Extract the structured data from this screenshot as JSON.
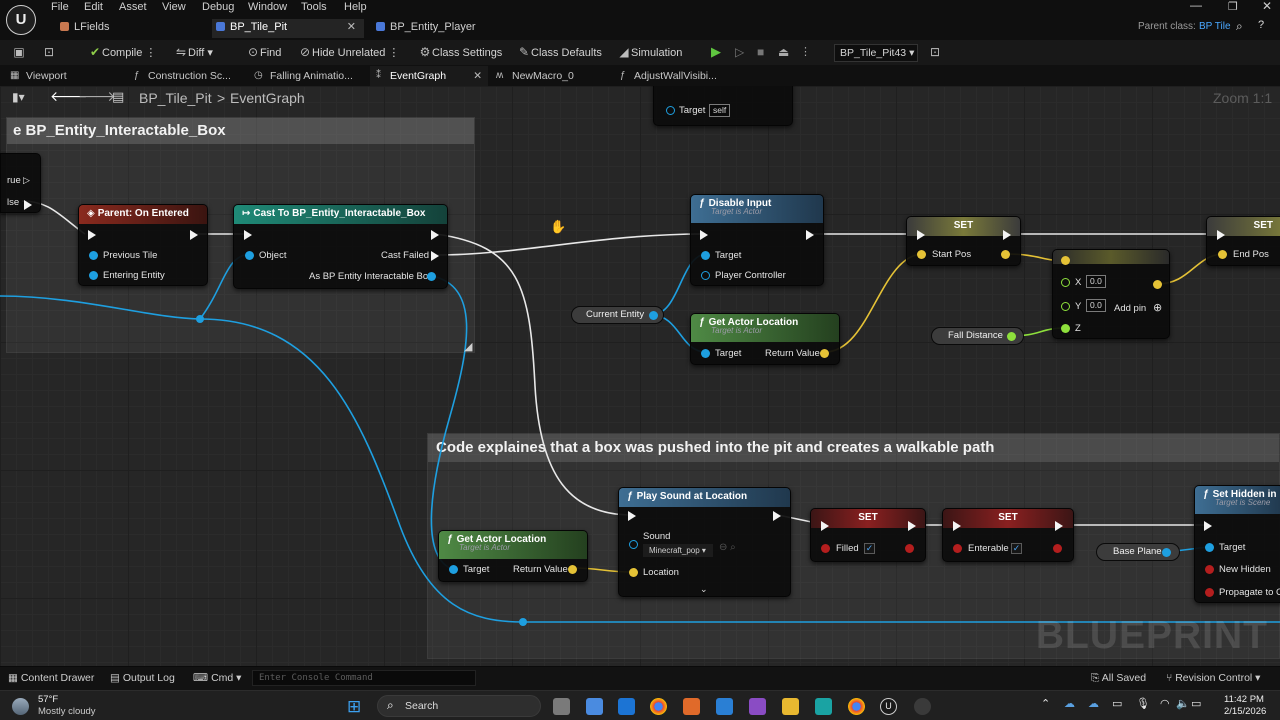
{
  "menu": {
    "items": [
      "File",
      "Edit",
      "Asset",
      "View",
      "Debug",
      "Window",
      "Tools",
      "Help"
    ]
  },
  "doc_tabs": [
    {
      "label": "LFields"
    },
    {
      "label": "BP_Tile_Pit"
    },
    {
      "label": "BP_Entity_Player"
    }
  ],
  "parent_class": {
    "label": "Parent class:",
    "value": "BP Tile"
  },
  "toolbar": {
    "compile": "Compile",
    "diff": "Diff",
    "find": "Find",
    "hide_unrelated": "Hide Unrelated",
    "class_settings": "Class Settings",
    "class_defaults": "Class Defaults",
    "simulation": "Simulation",
    "debug_object": "BP_Tile_Pit43"
  },
  "panel_tabs": [
    "Viewport",
    "Construction Sc...",
    "Falling Animatio...",
    "EventGraph",
    "NewMacro_0",
    "AdjustWallVisibi..."
  ],
  "breadcrumb": {
    "root": "BP_Tile_Pit",
    "sep": ">",
    "current": "EventGraph"
  },
  "zoom_label": "Zoom 1:1",
  "graph": {
    "comment_top": "e BP_Entity_Interactable_Box",
    "comment_bottom": "Code explaines that a box was pushed into the pit and creates a walkable path",
    "watermark": "BLUEPRINT",
    "partial_node": {
      "true_label": "rue",
      "false_label": "lse"
    },
    "top_node": {
      "target_label": "Target",
      "target_value": "self"
    },
    "nodes": {
      "on_entered": {
        "title": "Parent: On Entered",
        "pins": [
          "Previous Tile",
          "Entering Entity"
        ]
      },
      "cast": {
        "title": "Cast To BP_Entity_Interactable_Box",
        "pins": [
          "Object",
          "Cast Failed",
          "As BP Entity Interactable Box"
        ]
      },
      "disable_input": {
        "title": "Disable Input",
        "subtitle": "Target is Actor",
        "pins": [
          "Target",
          "Player Controller"
        ]
      },
      "get_loc1": {
        "title": "Get Actor Location",
        "subtitle": "Target is Actor",
        "pins": [
          "Target",
          "Return Value"
        ]
      },
      "current_entity": "Current Entity",
      "set_start": {
        "title": "SET",
        "pin": "Start Pos"
      },
      "make_vector": {
        "x_label": "X",
        "x_val": "0.0",
        "y_label": "Y",
        "y_val": "0.0",
        "z_label": "Z",
        "add_pin": "Add pin"
      },
      "fall_distance": "Fall Distance",
      "set_end": {
        "title": "SET",
        "pin": "End Pos"
      },
      "play_sound": {
        "title": "Play Sound at Location",
        "sound_label": "Sound",
        "sound_value": "Minecraft_pop",
        "location": "Location"
      },
      "get_loc2": {
        "title": "Get Actor Location",
        "subtitle": "Target is Actor",
        "pins": [
          "Target",
          "Return Value"
        ]
      },
      "set_filled": {
        "title": "SET",
        "pin": "Filled"
      },
      "set_enterable": {
        "title": "SET",
        "pin": "Enterable"
      },
      "base_plane": "Base Plane",
      "set_hidden": {
        "title": "Set Hidden in",
        "subtitle": "Target is Scene",
        "pins": [
          "Target",
          "New Hidden",
          "Propagate to C"
        ]
      }
    }
  },
  "statusbar": {
    "content_drawer": "Content Drawer",
    "output_log": "Output Log",
    "cmd": "Cmd",
    "console_placeholder": "Enter Console Command",
    "all_saved": "All Saved",
    "revision_control": "Revision Control"
  },
  "taskbar": {
    "temp": "57°F",
    "weather": "Mostly cloudy",
    "search": "Search",
    "time": "11:42 PM",
    "date": "2/15/2026"
  }
}
